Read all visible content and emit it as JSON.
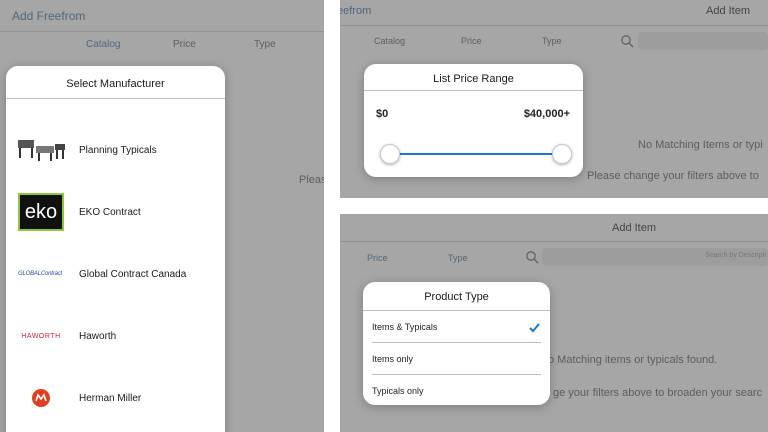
{
  "left_screen": {
    "header_link": "Add Freefrom",
    "tabs": [
      "Catalog",
      "Price",
      "Type"
    ],
    "background_hint": "Pleas",
    "popover": {
      "title": "Select Manufacturer",
      "manufacturers": [
        {
          "name": "Planning Typicals",
          "icon": "furniture-thumbnail-icon"
        },
        {
          "name": "EKO Contract",
          "icon": "eko-logo",
          "logo_text": "eko"
        },
        {
          "name": "Global Contract Canada",
          "icon": "global-contract-logo",
          "logo_text": "GLOBALContract"
        },
        {
          "name": "Haworth",
          "icon": "haworth-logo",
          "logo_text": "HAWORTH"
        },
        {
          "name": "Herman Miller",
          "icon": "herman-miller-logo"
        }
      ]
    }
  },
  "top_right_screen": {
    "header_link": "eefrom",
    "header_title": "Add Item",
    "tabs": [
      "Catalog",
      "Price",
      "Type"
    ],
    "empty_title": "No Matching Items or typi",
    "empty_hint": "Please change your filters above to",
    "popover": {
      "title": "List Price Range",
      "min_label": "$0",
      "max_label": "$40,000+",
      "range_min_fraction": 0,
      "range_max_fraction": 1
    }
  },
  "bottom_right_screen": {
    "header_title": "Add Item",
    "tabs": [
      "Price",
      "Type"
    ],
    "search_placeholder": "Search by Descripti",
    "empty_title": "o Matching items or typicals found.",
    "empty_hint": "ge your filters above to broaden your searc",
    "popover": {
      "title": "Product Type",
      "options": [
        {
          "label": "Items & Typicals",
          "selected": true
        },
        {
          "label": "Items only",
          "selected": false
        },
        {
          "label": "Typicals only",
          "selected": false
        }
      ]
    }
  },
  "colors": {
    "accent": "#1a7ac9",
    "link": "#5b7fa8",
    "eko_green": "#8cc63f",
    "haworth_red": "#d0203a",
    "herman_miller_red": "#e0401f"
  }
}
